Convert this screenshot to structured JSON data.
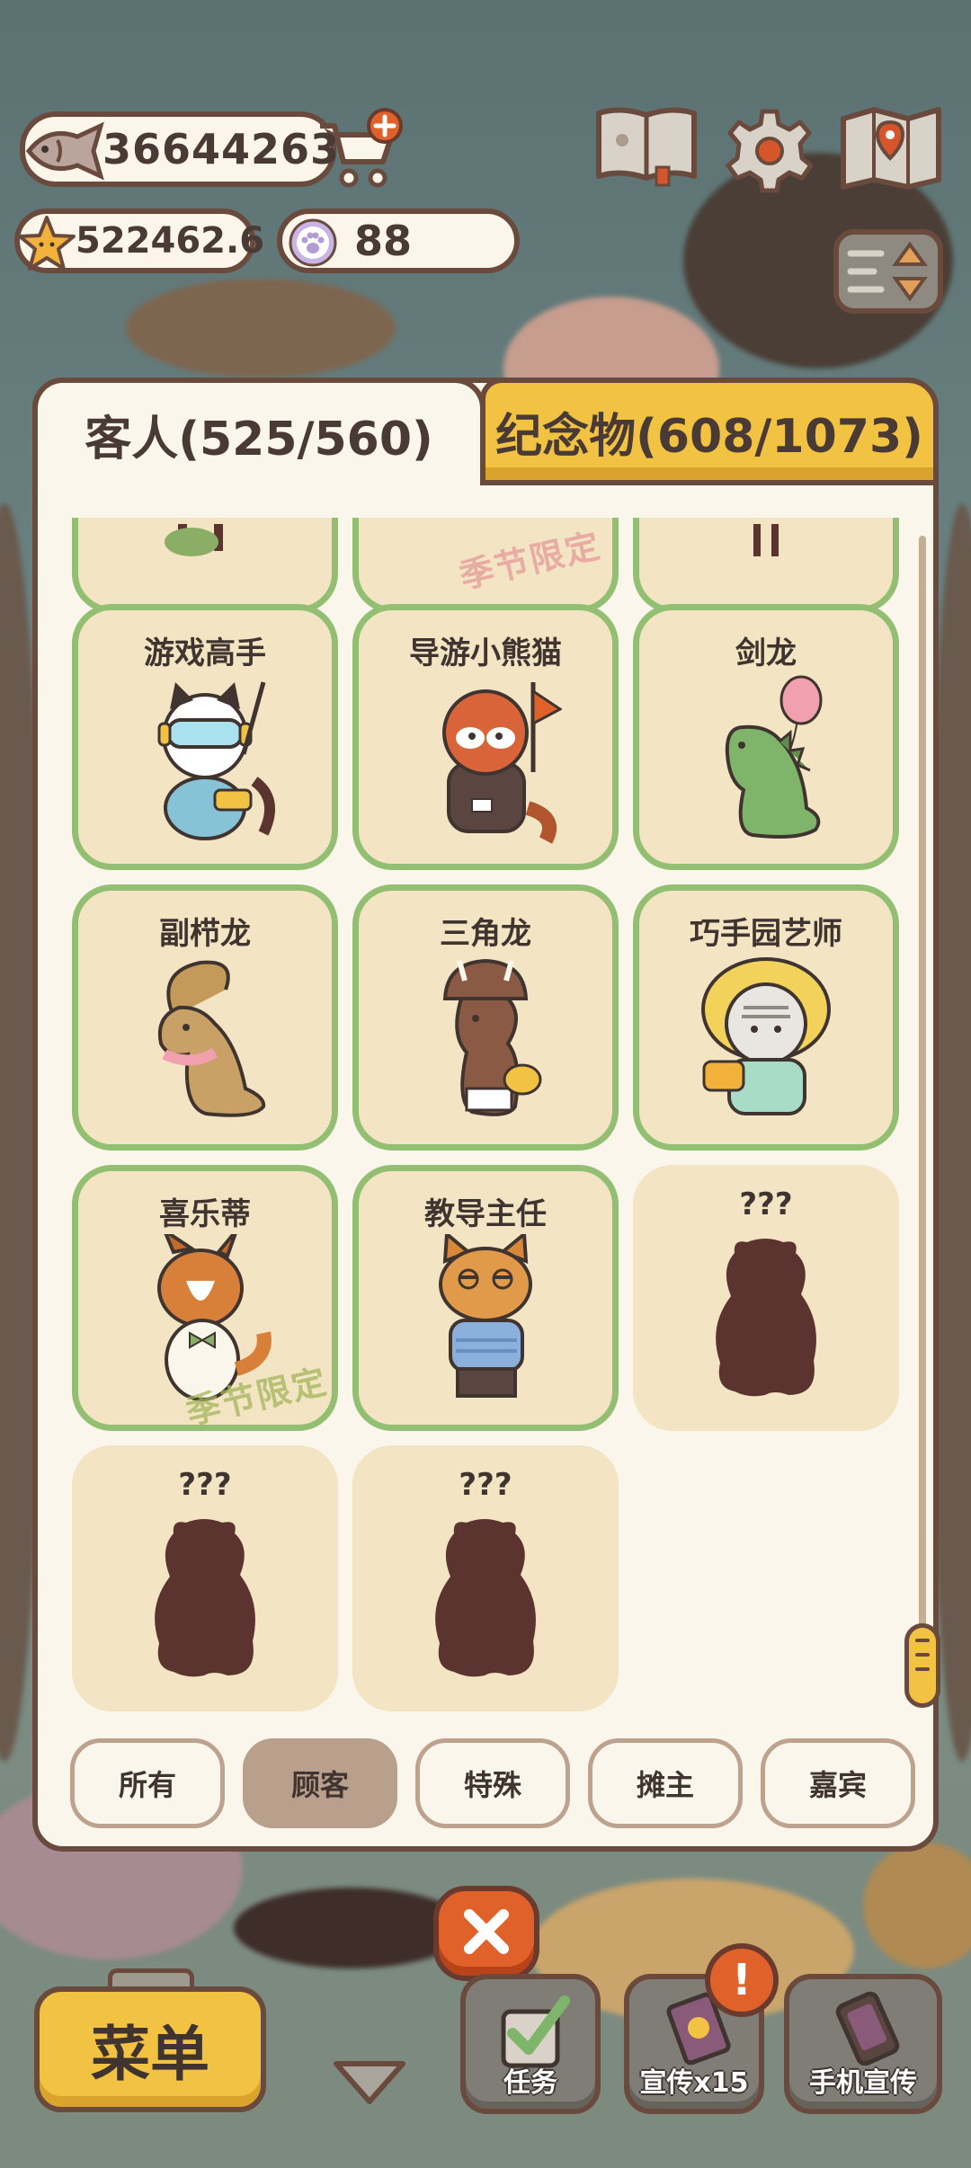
{
  "currency": {
    "fish": "36644263",
    "stars": "522462.6",
    "paw_coins": "88"
  },
  "tabs": {
    "guests": "客人(525/560)",
    "souvenirs": "纪念物(608/1073)"
  },
  "seasonal_stamp": "季节限定",
  "guests": [
    {
      "name": "游戏高手",
      "owned": true
    },
    {
      "name": "导游小熊猫",
      "owned": true
    },
    {
      "name": "剑龙",
      "owned": true
    },
    {
      "name": "副栉龙",
      "owned": true
    },
    {
      "name": "三角龙",
      "owned": true
    },
    {
      "name": "巧手园艺师",
      "owned": true
    },
    {
      "name": "喜乐蒂",
      "owned": true,
      "seasonal": true
    },
    {
      "name": "教导主任",
      "owned": true
    },
    {
      "name": "???",
      "owned": false
    },
    {
      "name": "???",
      "owned": false
    },
    {
      "name": "???",
      "owned": false
    }
  ],
  "filters": [
    {
      "label": "所有",
      "active": false
    },
    {
      "label": "顾客",
      "active": true
    },
    {
      "label": "特殊",
      "active": false
    },
    {
      "label": "摊主",
      "active": false
    },
    {
      "label": "嘉宾",
      "active": false
    }
  ],
  "bottom_bar": {
    "menu": "菜单",
    "task": "任务",
    "promote": "宣传x15",
    "phone_promote": "手机宣传",
    "alert": "!"
  },
  "colors": {
    "owned_border": "#93bf72",
    "card_bg": "#f3e4c3",
    "accent_yellow": "#f2c242",
    "outline_brown": "#6b4a3e",
    "close_orange": "#e0622a",
    "silhouette": "#5b3430"
  }
}
